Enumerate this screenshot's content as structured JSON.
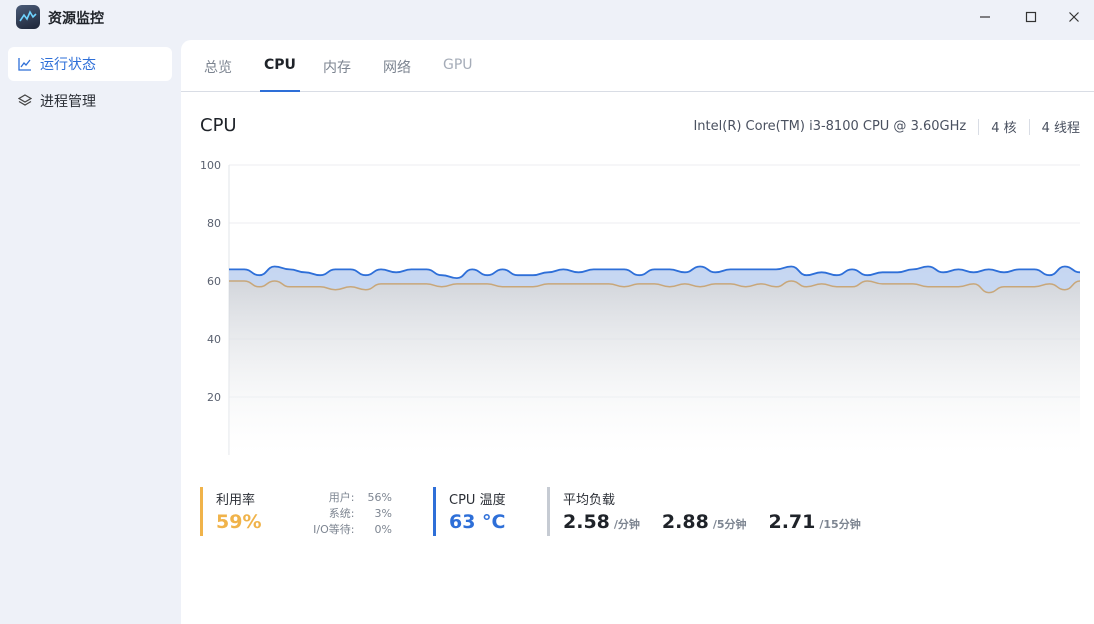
{
  "app": {
    "title": "资源监控"
  },
  "sidebar": {
    "items": [
      {
        "label": "运行状态",
        "icon": "trend-chart-icon",
        "active": true
      },
      {
        "label": "进程管理",
        "icon": "layers-icon",
        "active": false
      }
    ]
  },
  "tabs": [
    {
      "label": "总览"
    },
    {
      "label": "CPU",
      "active": true
    },
    {
      "label": "内存"
    },
    {
      "label": "网络"
    },
    {
      "label": "GPU",
      "disabled": true
    }
  ],
  "cpu": {
    "title": "CPU",
    "model": "Intel(R) Core(TM) i3-8100 CPU @ 3.60GHz",
    "cores": "4 核",
    "threads": "4 线程"
  },
  "chart_data": {
    "type": "area",
    "ylim": [
      0,
      100
    ],
    "yticks": [
      "100",
      "80",
      "60",
      "40",
      "20"
    ],
    "grid": true,
    "series": [
      {
        "color": "#2e6fd8",
        "values": [
          64,
          64,
          62,
          65,
          64,
          63,
          62,
          64,
          64,
          62,
          64,
          63,
          64,
          64,
          62,
          61,
          64,
          62,
          64,
          62,
          62,
          63,
          64,
          63,
          64,
          64,
          64,
          62,
          64,
          64,
          63,
          65,
          63,
          64,
          64,
          64,
          64,
          65,
          62,
          63,
          62,
          64,
          62,
          63,
          63,
          64,
          65,
          63,
          64,
          63,
          64,
          63,
          64,
          64,
          62,
          65,
          63
        ]
      },
      {
        "color": "#c8a77a",
        "values": [
          60,
          60,
          58,
          60,
          58,
          58,
          58,
          57,
          58,
          57,
          59,
          59,
          59,
          59,
          58,
          59,
          59,
          59,
          58,
          58,
          58,
          59,
          59,
          59,
          59,
          59,
          58,
          59,
          59,
          58,
          59,
          58,
          59,
          59,
          58,
          59,
          58,
          60,
          58,
          59,
          58,
          58,
          60,
          59,
          59,
          59,
          58,
          58,
          58,
          59,
          56,
          58,
          58,
          58,
          59,
          57,
          60
        ]
      }
    ]
  },
  "stats": {
    "util": {
      "label": "利用率",
      "value": "59%",
      "color": "#f0b34a",
      "user_label": "用户:",
      "user_value": "56%",
      "sys_label": "系统:",
      "sys_value": "3%",
      "io_label": "I/O等待:",
      "io_value": "0%"
    },
    "temp": {
      "label": "CPU 温度",
      "value": "63 °C",
      "color": "#2e6fd8"
    },
    "load": {
      "label": "平均负载",
      "color": "#c6cbd3",
      "l1": "2.58",
      "l1_unit": "/分钟",
      "l5": "2.88",
      "l5_unit": "/5分钟",
      "l15": "2.71",
      "l15_unit": "/15分钟"
    }
  }
}
